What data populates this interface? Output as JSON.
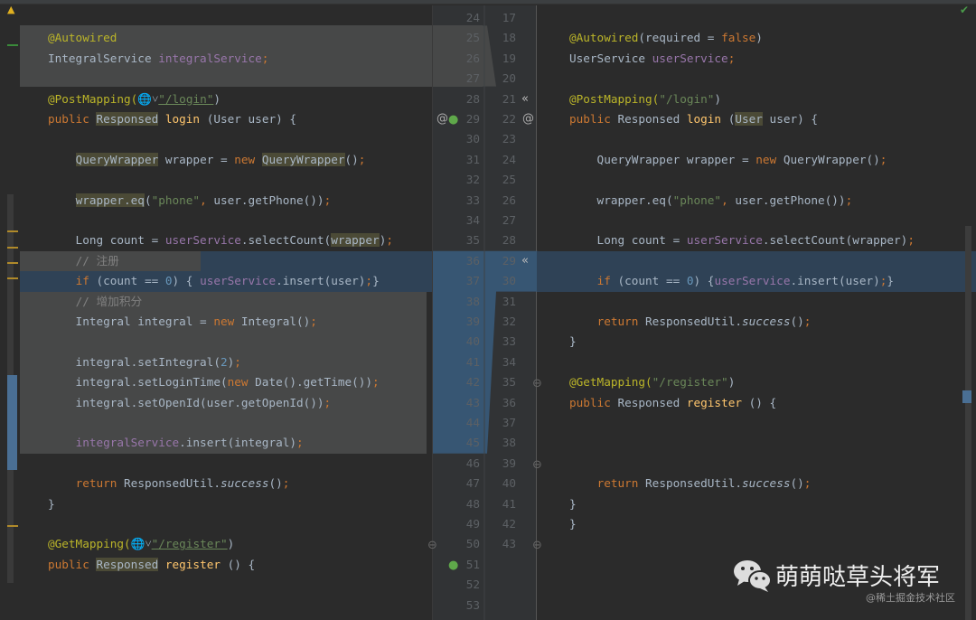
{
  "editor": {
    "left_start_line": 24,
    "right_start_line": 17,
    "left_line_count": 30,
    "right_line_count": 27,
    "status_icon": "warning-icon",
    "right_status_icon": "check-icon",
    "colors": {
      "background": "#2b2b2b",
      "changed": "#474848",
      "modified": "#2f4256",
      "gutter_modified": "#375673"
    }
  },
  "left_code": [
    [],
    [
      [
        "@Autowired",
        "an"
      ]
    ],
    [
      [
        "IntegralService ",
        ""
      ],
      [
        "integralService",
        "fld"
      ],
      [
        ";",
        "kw"
      ]
    ],
    [],
    [
      [
        "@PostMapping(",
        "an"
      ],
      [
        "🌐˅",
        ""
      ],
      [
        "\"/login\"",
        "str u"
      ],
      [
        ")",
        ""
      ]
    ],
    [
      [
        "public ",
        "kw"
      ],
      [
        "Responsed",
        "ty"
      ],
      [
        " ",
        ""
      ],
      [
        "login",
        "fn"
      ],
      [
        " (User user) {",
        ""
      ]
    ],
    [],
    [
      [
        "    ",
        ""
      ],
      [
        "QueryWrapper",
        "ty"
      ],
      [
        " wrapper = ",
        ""
      ],
      [
        "new ",
        "kw"
      ],
      [
        "QueryWrapper",
        "ty"
      ],
      [
        "()",
        ""
      ],
      [
        ";",
        "kw"
      ]
    ],
    [],
    [
      [
        "    ",
        ""
      ],
      [
        "wrapper.eq",
        "ty"
      ],
      [
        "(",
        ""
      ],
      [
        "\"phone\"",
        "str"
      ],
      [
        ", ",
        "kw"
      ],
      [
        "user.getPhone())",
        ""
      ],
      [
        ";",
        "kw"
      ]
    ],
    [],
    [
      [
        "    Long count = ",
        ""
      ],
      [
        "userService",
        "fld"
      ],
      [
        ".selectCount(",
        ""
      ],
      [
        "wrapper",
        "ty"
      ],
      [
        ")",
        ""
      ],
      [
        ";",
        "kw"
      ]
    ],
    [
      [
        "    ",
        ""
      ],
      [
        "// 注册",
        "cm"
      ]
    ],
    [
      [
        "    ",
        ""
      ],
      [
        "if ",
        "kw"
      ],
      [
        "(count == ",
        ""
      ],
      [
        "0",
        "num"
      ],
      [
        ") { ",
        ""
      ],
      [
        "userService",
        "fld"
      ],
      [
        ".insert(user)",
        ""
      ],
      [
        ";",
        "kw"
      ],
      [
        "}",
        ""
      ]
    ],
    [
      [
        "    ",
        ""
      ],
      [
        "// 增加积分",
        "cm"
      ]
    ],
    [
      [
        "    Integral integral = ",
        ""
      ],
      [
        "new ",
        "kw"
      ],
      [
        "Integral()",
        ""
      ],
      [
        ";",
        "kw"
      ]
    ],
    [],
    [
      [
        "    integral.setIntegral(",
        ""
      ],
      [
        "2",
        "num"
      ],
      [
        ")",
        ""
      ],
      [
        ";",
        "kw"
      ]
    ],
    [
      [
        "    integral.setLoginTime(",
        ""
      ],
      [
        "new ",
        "kw"
      ],
      [
        "Date().getTime())",
        ""
      ],
      [
        ";",
        "kw"
      ]
    ],
    [
      [
        "    integral.setOpenId(user.getOpenId())",
        ""
      ],
      [
        ";",
        "kw"
      ]
    ],
    [],
    [
      [
        "    ",
        ""
      ],
      [
        "integralService",
        "fld"
      ],
      [
        ".insert(integral)",
        ""
      ],
      [
        ";",
        "kw"
      ]
    ],
    [],
    [
      [
        "    ",
        ""
      ],
      [
        "return ",
        "kw"
      ],
      [
        "ResponsedUtil.",
        ""
      ],
      [
        "success",
        "it"
      ],
      [
        "()",
        ""
      ],
      [
        ";",
        "kw"
      ]
    ],
    [
      [
        "}",
        ""
      ]
    ],
    [],
    [
      [
        "@GetMapping(",
        "an"
      ],
      [
        "🌐˅",
        ""
      ],
      [
        "\"/register\"",
        "str u"
      ],
      [
        ")",
        ""
      ]
    ],
    [
      [
        "public ",
        "kw"
      ],
      [
        "Responsed",
        "ty"
      ],
      [
        " ",
        ""
      ],
      [
        "register",
        "fn"
      ],
      [
        " () {",
        ""
      ]
    ],
    [],
    []
  ],
  "right_code": [
    [],
    [
      [
        "@Autowired",
        "an"
      ],
      [
        "(required = ",
        ""
      ],
      [
        "false",
        "kw"
      ],
      [
        ")",
        ""
      ]
    ],
    [
      [
        "UserService ",
        ""
      ],
      [
        "userService",
        "fld"
      ],
      [
        ";",
        "kw"
      ]
    ],
    [],
    [
      [
        "@PostMapping(",
        "an"
      ],
      [
        "\"/login\"",
        "str"
      ],
      [
        ")",
        ""
      ]
    ],
    [
      [
        "public ",
        "kw"
      ],
      [
        "Responsed ",
        ""
      ],
      [
        "login",
        "fn"
      ],
      [
        " (",
        ""
      ],
      [
        "User",
        "ty"
      ],
      [
        " user) {",
        ""
      ]
    ],
    [],
    [
      [
        "    QueryWrapper wrapper = ",
        ""
      ],
      [
        "new ",
        "kw"
      ],
      [
        "QueryWrapper()",
        ""
      ],
      [
        ";",
        "kw"
      ]
    ],
    [],
    [
      [
        "    wrapper.eq(",
        ""
      ],
      [
        "\"phone\"",
        "str"
      ],
      [
        ", ",
        "kw"
      ],
      [
        "user.getPhone())",
        ""
      ],
      [
        ";",
        "kw"
      ]
    ],
    [],
    [
      [
        "    Long count = ",
        ""
      ],
      [
        "userService",
        "fld"
      ],
      [
        ".selectCount(wrapper)",
        ""
      ],
      [
        ";",
        "kw"
      ]
    ],
    [],
    [
      [
        "    ",
        ""
      ],
      [
        "if ",
        "kw"
      ],
      [
        "(count == ",
        ""
      ],
      [
        "0",
        "num"
      ],
      [
        ") {",
        ""
      ],
      [
        "userService",
        "fld"
      ],
      [
        ".insert(user)",
        ""
      ],
      [
        ";",
        "kw"
      ],
      [
        "}",
        ""
      ]
    ],
    [],
    [
      [
        "    ",
        ""
      ],
      [
        "return ",
        "kw"
      ],
      [
        "ResponsedUtil.",
        ""
      ],
      [
        "success",
        "it"
      ],
      [
        "()",
        ""
      ],
      [
        ";",
        "kw"
      ]
    ],
    [
      [
        "}",
        ""
      ]
    ],
    [],
    [
      [
        "@GetMapping(",
        "an"
      ],
      [
        "\"/register\"",
        "str"
      ],
      [
        ")",
        ""
      ]
    ],
    [
      [
        "public ",
        "kw"
      ],
      [
        "Responsed ",
        ""
      ],
      [
        "register",
        "fn"
      ],
      [
        " () {",
        ""
      ]
    ],
    [],
    [],
    [],
    [
      [
        "    ",
        ""
      ],
      [
        "return ",
        "kw"
      ],
      [
        "ResponsedUtil.",
        ""
      ],
      [
        "success",
        "it"
      ],
      [
        "()",
        ""
      ],
      [
        ";",
        "kw"
      ]
    ],
    [
      [
        "}",
        ""
      ]
    ],
    [
      [
        "}",
        ""
      ]
    ],
    []
  ],
  "watermark": {
    "title": "萌萌哒草头将军",
    "subtitle": "@稀土掘金技术社区",
    "icon": "wechat-icon"
  }
}
